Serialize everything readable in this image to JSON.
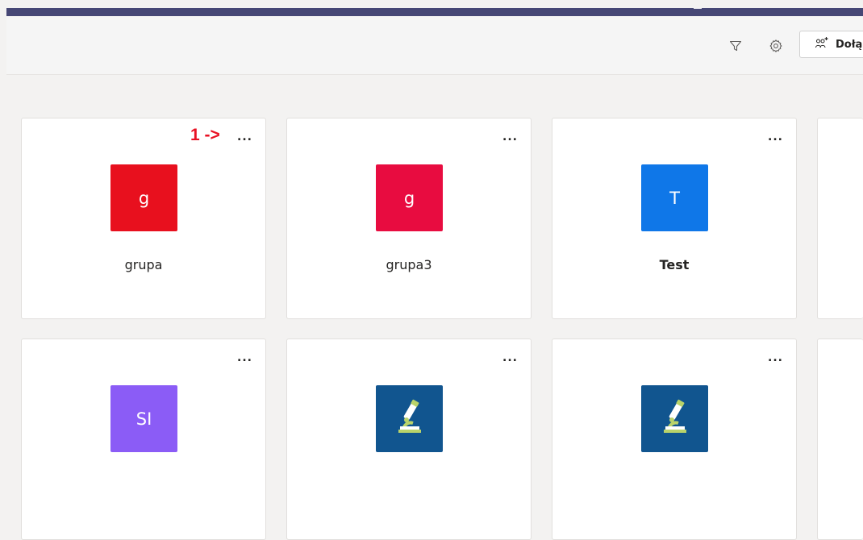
{
  "header": {
    "icons": [
      "filter-icon",
      "gear-icon"
    ],
    "join_button": {
      "icon": "people-add-icon",
      "label": "Dołą"
    }
  },
  "annotation": "1 ->",
  "teams": [
    {
      "name": "grupa",
      "initial": "g",
      "color": "#e8101e",
      "bold": false,
      "icon": "letter"
    },
    {
      "name": "grupa3",
      "initial": "g",
      "color": "#e80c40",
      "bold": false,
      "icon": "letter"
    },
    {
      "name": "Test",
      "initial": "T",
      "color": "#0f77e8",
      "bold": true,
      "icon": "letter"
    },
    {
      "name": "",
      "initial": "SI",
      "color": "#8b5cf6",
      "bold": false,
      "icon": "letter"
    },
    {
      "name": "",
      "initial": "",
      "color": "#11558f",
      "bold": false,
      "icon": "microscope-icon"
    },
    {
      "name": "",
      "initial": "",
      "color": "#11558f",
      "bold": false,
      "icon": "microscope-icon"
    }
  ],
  "more_options_label": "..."
}
